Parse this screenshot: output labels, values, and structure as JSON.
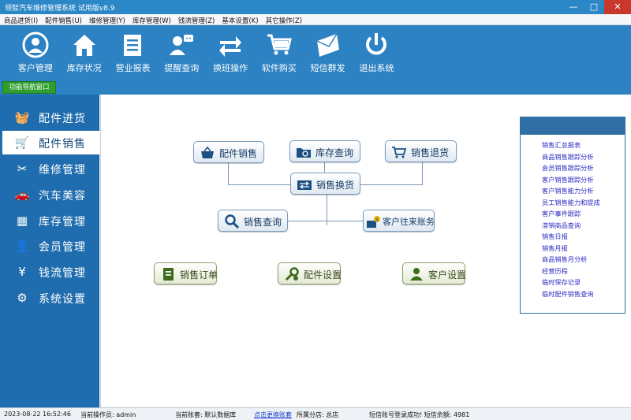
{
  "window": {
    "title": "领智汽车维修管理系统 试用版v8.9",
    "minimize": "—",
    "maximize": "□",
    "close": "✕"
  },
  "menu": [
    "商品进货(I)",
    "配件销售(U)",
    "维修管理(Y)",
    "库存管理(W)",
    "钱流管理(Z)",
    "基本设置(K)",
    "其它操作(Z)"
  ],
  "toolbar": [
    {
      "label": "客户管理",
      "icon": "customer-icon"
    },
    {
      "label": "库存状况",
      "icon": "home-icon"
    },
    {
      "label": "营业报表",
      "icon": "report-icon"
    },
    {
      "label": "提醒查询",
      "icon": "reminder-icon"
    },
    {
      "label": "换班操作",
      "icon": "shift-icon"
    },
    {
      "label": "软件购买",
      "icon": "cart-icon"
    },
    {
      "label": "短信群发",
      "icon": "mail-icon"
    },
    {
      "label": "退出系统",
      "icon": "power-icon"
    }
  ],
  "nav_tab": "功能导航窗口",
  "sidebar": [
    {
      "label": "配件进货",
      "icon": "basket-icon",
      "glyph": "🧺",
      "active": false
    },
    {
      "label": "配件销售",
      "icon": "cart-icon",
      "glyph": "🛒",
      "active": true
    },
    {
      "label": "维修管理",
      "icon": "tools-icon",
      "glyph": "✂",
      "active": false
    },
    {
      "label": "汽车美容",
      "icon": "car-icon",
      "glyph": "🚗",
      "active": false
    },
    {
      "label": "库存管理",
      "icon": "grid-icon",
      "glyph": "▦",
      "active": false
    },
    {
      "label": "会员管理",
      "icon": "user-icon",
      "glyph": "👤",
      "active": false
    },
    {
      "label": "钱流管理",
      "icon": "yen-icon",
      "glyph": "¥",
      "active": false
    },
    {
      "label": "系统设置",
      "icon": "gear-icon",
      "glyph": "⚙",
      "active": false
    }
  ],
  "flow": {
    "parts_sales": "配件销售",
    "stock_query": "库存查询",
    "sales_return": "销售退货",
    "sales_exchange": "销售换货",
    "sales_query": "销售查询",
    "customer_accounts": "客户往来账务",
    "sales_order": "销售订单",
    "parts_settings": "配件设置",
    "customer_settings": "客户设置"
  },
  "reports": [
    "销售汇总报表",
    "商品销售跟踪分析",
    "会员销售跟踪分析",
    "客户销售跟踪分析",
    "客户销售能力分析",
    "员工销售能力和提成",
    "客户事件跟踪",
    "滞销商品查询",
    "销售日报",
    "销售月报",
    "商品销售月分析",
    "经营历程",
    "临时保存记录",
    "临时配件销售查询"
  ],
  "status": {
    "datetime": "2023-08-22 16:52:46",
    "operator": "当前操作员: admin",
    "account": "当前账套: 默认数据库",
    "switch_link": "点击更换账套",
    "branch": "所属分店: 总店",
    "sms": "短信账号登录成功!  短信余额: 4981"
  },
  "colors": {
    "accent": "#2c82c2",
    "sidebar": "#1f6dae",
    "active_tab": "#2e9e2e",
    "link": "#2b2bc2"
  }
}
